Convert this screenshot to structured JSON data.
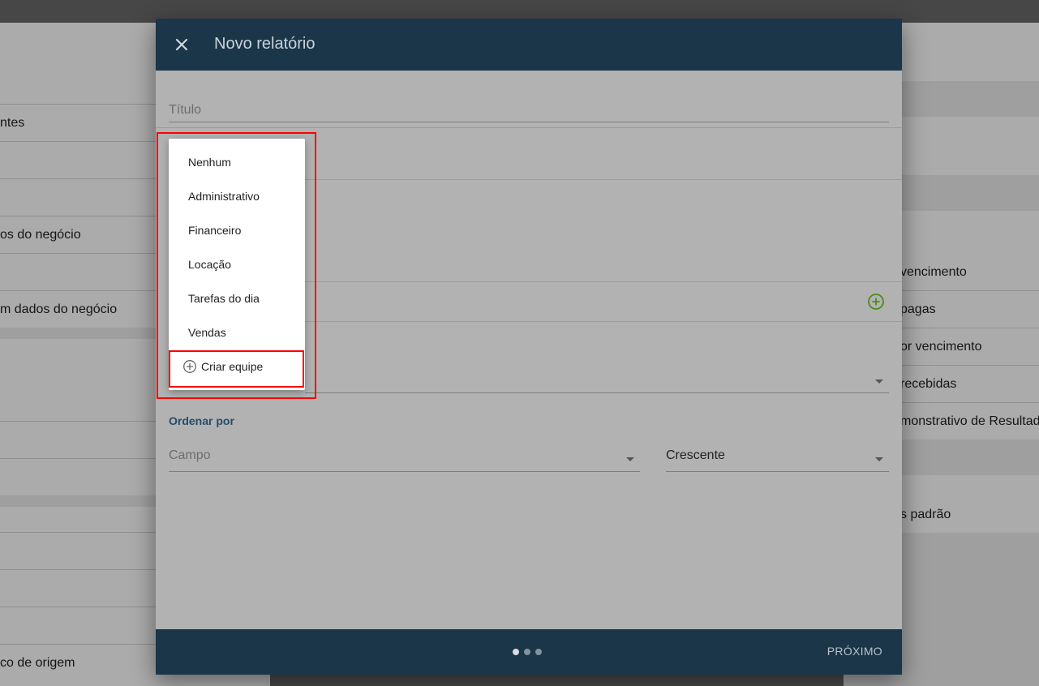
{
  "background": {
    "left_items": [
      "ntes",
      "os do negócio",
      "m dados do negócio",
      "co de origem"
    ],
    "right_items": [
      "vencimento",
      "pagas",
      "or vencimento",
      "recebidas",
      "monstrativo de Resultad",
      "s padrão"
    ]
  },
  "dialog": {
    "title": "Novo relatório",
    "title_field": {
      "placeholder": "Título"
    },
    "order_by_label": "Ordenar por",
    "field_placeholder": "Campo",
    "sort_value": "Crescente",
    "next_label": "PRÓXIMO",
    "colors": {
      "header": "#1b3549",
      "add_icon": "#4b8c1a",
      "section_label": "#244d6c"
    }
  },
  "team_menu": {
    "items": [
      "Nenhum",
      "Administrativo",
      "Financeiro",
      "Locação",
      "Tarefas do dia",
      "Vendas"
    ],
    "create_label": "Criar equipe"
  },
  "pager": {
    "steps": 3,
    "active_step": 1
  }
}
